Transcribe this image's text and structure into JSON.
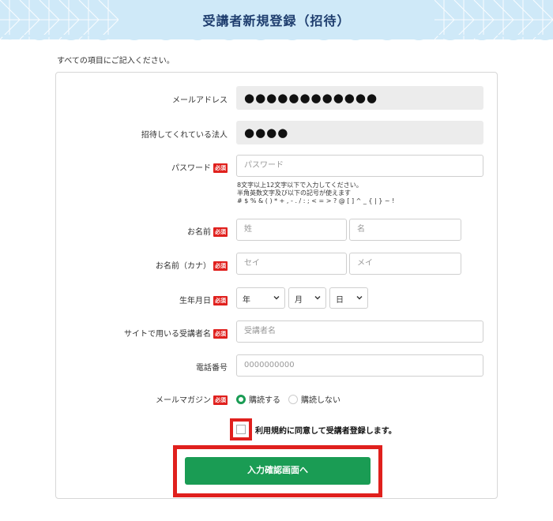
{
  "header": {
    "title": "受講者新規登録（招待）"
  },
  "intro": "すべての項目にご記入ください。",
  "required_badge": "必須",
  "form": {
    "email": {
      "label": "メールアドレス",
      "value": "●●●●●●●●●●●●"
    },
    "inviter": {
      "label": "招待してくれている法人",
      "value": "●●●●"
    },
    "password": {
      "label": "パスワード",
      "placeholder": "パスワード",
      "hint_lines": [
        "8文字以上12文字以下で入力してください。",
        "半角英数文字及び以下の記号が使えます",
        "# $ % & ( ) * + , - . / : ; < = > ? @ [ ] ^ _ { | } ~ !"
      ]
    },
    "name": {
      "label": "お名前",
      "last_placeholder": "姓",
      "first_placeholder": "名"
    },
    "name_kana": {
      "label": "お名前（カナ）",
      "last_placeholder": "セイ",
      "first_placeholder": "メイ"
    },
    "birthdate": {
      "label": "生年月日",
      "year": "年",
      "month": "月",
      "day": "日"
    },
    "site_name": {
      "label": "サイトで用いる受講者名",
      "placeholder": "受講者名"
    },
    "phone": {
      "label": "電話番号",
      "placeholder": "0000000000"
    },
    "magazine": {
      "label": "メールマガジン",
      "options": [
        "購読する",
        "購読しない"
      ],
      "selected": "購読する"
    },
    "agree_text": "利用規約に同意して受講者登録します。",
    "submit_label": "入力確認画面へ"
  },
  "colors": {
    "accent_green": "#1a9c54",
    "required_red": "#e0201d",
    "header_bg": "#cfe9f8",
    "header_text": "#1e3d6e"
  }
}
